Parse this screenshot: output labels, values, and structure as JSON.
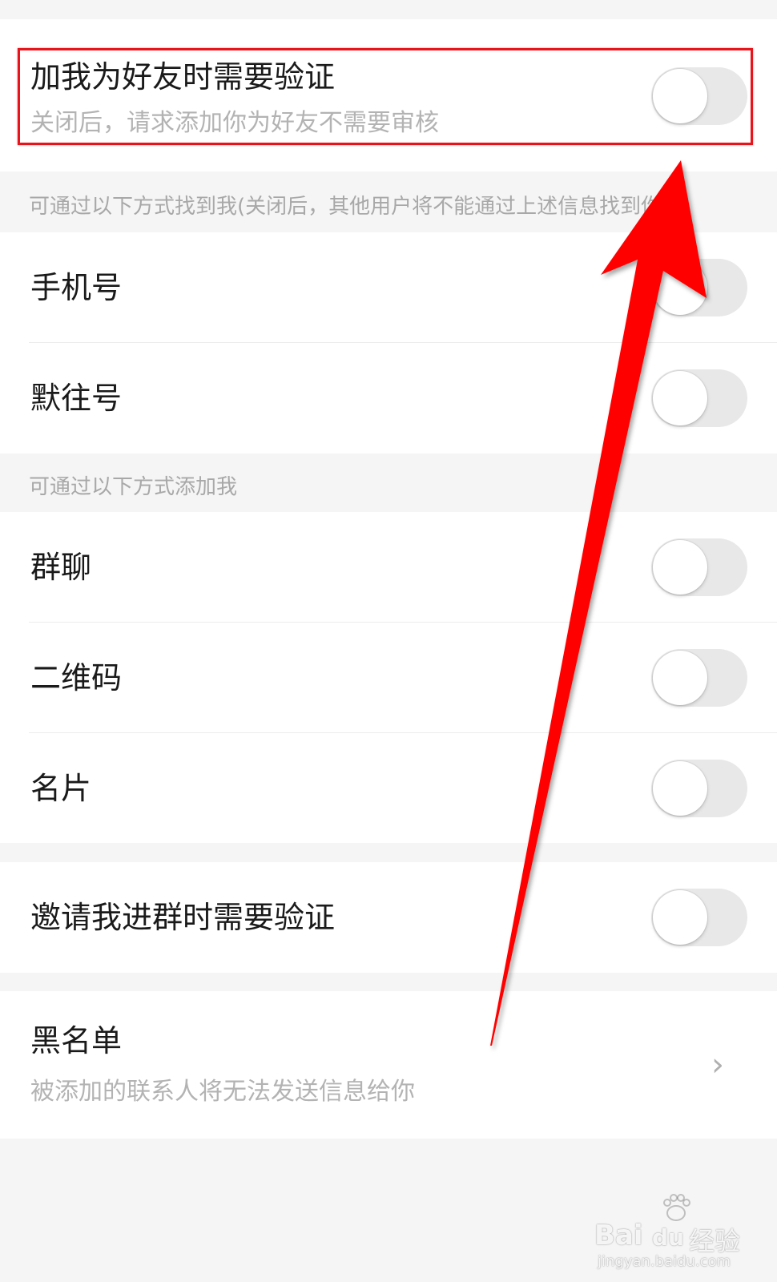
{
  "verify_section": {
    "title": "加我为好友时需要验证",
    "subtitle": "关闭后，请求添加你为好友不需要审核",
    "toggle_on": false
  },
  "find_me_section": {
    "header": "可通过以下方式找到我(关闭后，其他用户将不能通过上述信息找到你)",
    "items": [
      {
        "label": "手机号",
        "toggle_on": false
      },
      {
        "label": "默往号",
        "toggle_on": false
      }
    ]
  },
  "add_me_section": {
    "header": "可通过以下方式添加我",
    "items": [
      {
        "label": "群聊",
        "toggle_on": false
      },
      {
        "label": "二维码",
        "toggle_on": false
      },
      {
        "label": "名片",
        "toggle_on": false
      }
    ]
  },
  "group_invite": {
    "label": "邀请我进群时需要验证",
    "toggle_on": false
  },
  "blacklist": {
    "title": "黑名单",
    "subtitle": "被添加的联系人将无法发送信息给你",
    "chevron": "›"
  },
  "annotation": {
    "highlight_color": "#e8141b",
    "arrow_color": "#ff0000"
  },
  "watermark": {
    "brand": "Bai",
    "brand_paw": "du",
    "product": "经验",
    "url": "jingyan.baidu.com"
  },
  "icons": {
    "chevron": "chevron-right-icon",
    "arrow": "red-arrow-icon",
    "paw": "baidu-paw-icon"
  }
}
